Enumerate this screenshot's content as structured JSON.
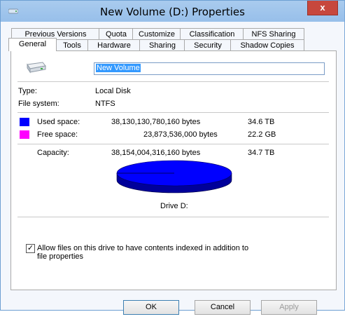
{
  "window": {
    "title": "New Volume (D:) Properties",
    "close_glyph": "x"
  },
  "tabs_row1": [
    "Previous Versions",
    "Quota",
    "Customize",
    "Classification",
    "NFS Sharing"
  ],
  "tabs_row2": [
    "General",
    "Tools",
    "Hardware",
    "Sharing",
    "Security",
    "Shadow Copies"
  ],
  "active_tab": "General",
  "general": {
    "volume_name": "New Volume",
    "type_label": "Type:",
    "type_value": "Local Disk",
    "fs_label": "File system:",
    "fs_value": "NTFS",
    "used_label": "Used space:",
    "used_bytes": "38,130,130,780,160 bytes",
    "used_size": "34.6 TB",
    "used_color": "#0000ff",
    "free_label": "Free space:",
    "free_bytes": "23,873,536,000 bytes",
    "free_size": "22.2 GB",
    "free_color": "#ff00ff",
    "capacity_label": "Capacity:",
    "capacity_bytes": "38,154,004,316,160 bytes",
    "capacity_size": "34.7 TB",
    "drive_label": "Drive D:",
    "index_checkbox_checked": true,
    "index_label_line1": "Allow files on this drive to have contents indexed in addition to",
    "index_label_line2": "file properties"
  },
  "chart_data": {
    "type": "pie",
    "labels": [
      "Used space",
      "Free space"
    ],
    "values": [
      38130130780160,
      23873536000
    ],
    "colors": [
      "#0000ff",
      "#ff00ff"
    ]
  },
  "buttons": {
    "ok": "OK",
    "cancel": "Cancel",
    "apply": "Apply"
  }
}
